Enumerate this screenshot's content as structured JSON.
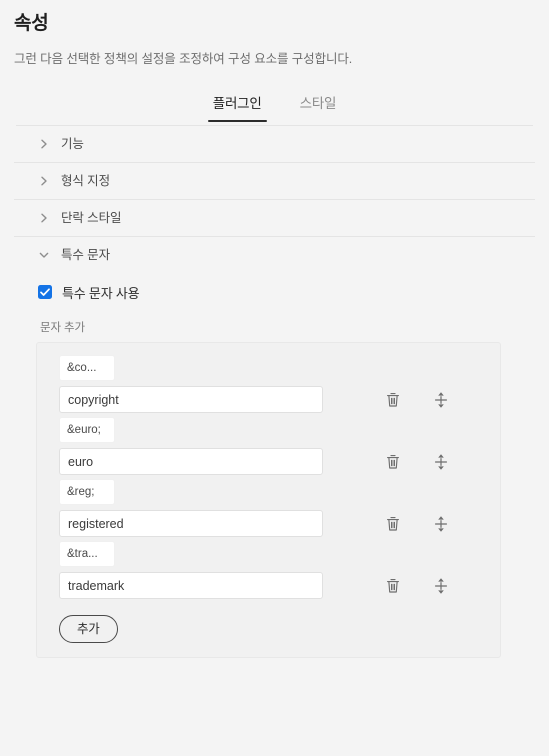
{
  "header": {
    "title": "속성",
    "description": "그런 다음 선택한 정책의 설정을 조정하여 구성 요소를 구성합니다."
  },
  "tabs": [
    {
      "label": "플러그인",
      "active": true
    },
    {
      "label": "스타일",
      "active": false
    }
  ],
  "accordion": [
    {
      "label": "기능",
      "expanded": false,
      "icon": "chevron-right-icon"
    },
    {
      "label": "형식 지정",
      "expanded": false,
      "icon": "chevron-right-icon"
    },
    {
      "label": "단락 스타일",
      "expanded": false,
      "icon": "chevron-right-icon"
    },
    {
      "label": "특수 문자",
      "expanded": true,
      "icon": "chevron-down-icon"
    }
  ],
  "special_characters": {
    "checkbox": {
      "label": "특수 문자 사용",
      "checked": true
    },
    "group_label": "문자 추가",
    "rows": [
      {
        "entity": "&co...",
        "name": "copyright"
      },
      {
        "entity": "&euro;",
        "name": "euro"
      },
      {
        "entity": "&reg;",
        "name": "registered"
      },
      {
        "entity": "&tra...",
        "name": "trademark"
      }
    ],
    "row_actions": {
      "delete_icon": "trash-icon",
      "reorder_icon": "drag-vertical-icon"
    },
    "add_button": "추가"
  },
  "colors": {
    "background": "#f4f4f4",
    "accent": "#1473e6",
    "text": "#2c2c2c",
    "muted_text": "#6e6e6e",
    "divider": "#e4e4e4",
    "panel_bg": "#f1f1f1",
    "input_bg": "#ffffff"
  }
}
